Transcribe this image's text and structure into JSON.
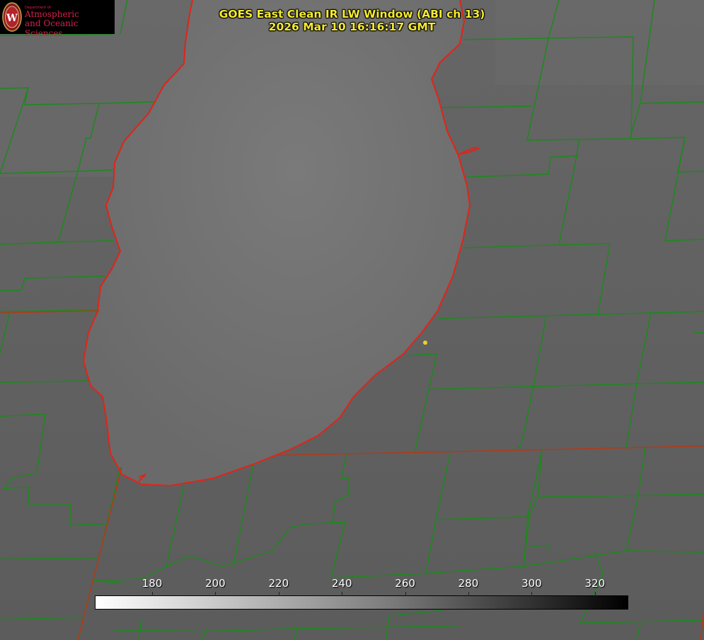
{
  "title": {
    "line1": "GOES East Clean IR LW Window (ABI ch 13)",
    "line2": "2026 Mar 10 16:16:17 GMT"
  },
  "logo": {
    "dept": "Department of",
    "line1": "Atmospheric",
    "line2": "and Oceanic Sciences",
    "seal_letter": "W"
  },
  "colorbar": {
    "ticks": [
      "180",
      "200",
      "220",
      "240",
      "260",
      "280",
      "300",
      "320"
    ]
  },
  "colors": {
    "county_line": "#1a8a1a",
    "coast_line": "#e02418",
    "title_text": "#f5ea2e",
    "marker": "#e8d22a"
  }
}
